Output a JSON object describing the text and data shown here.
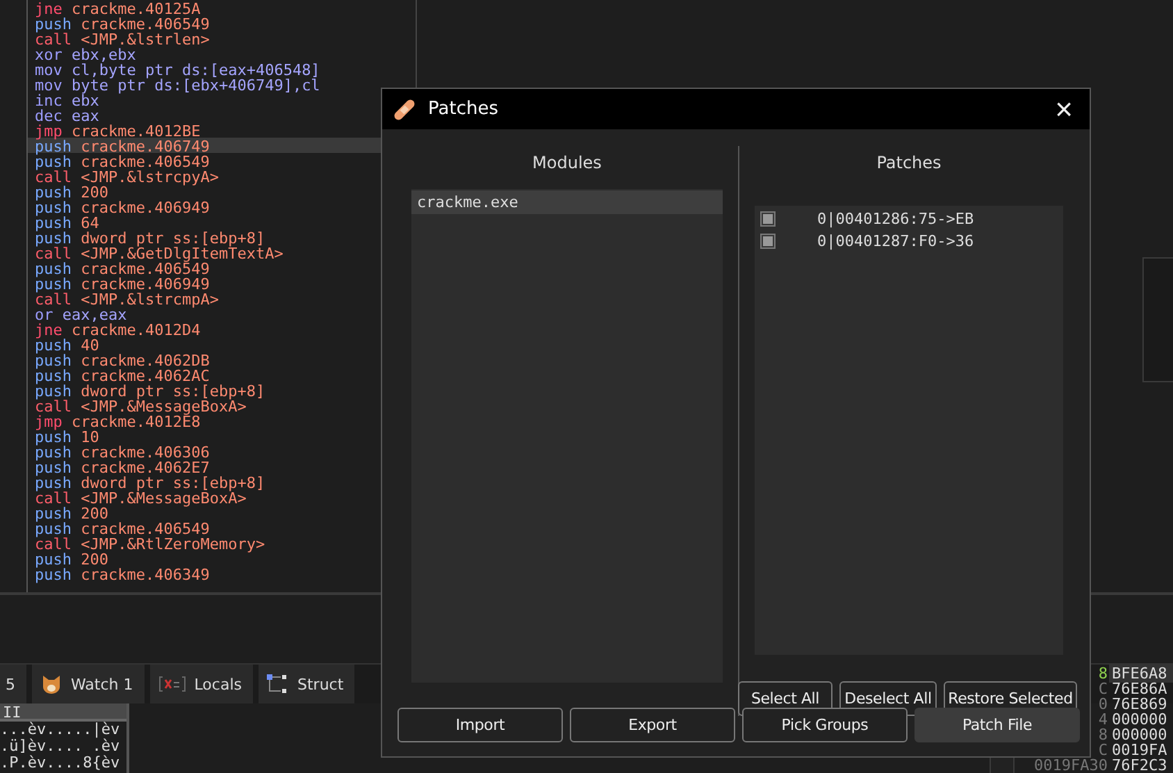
{
  "disassembly": [
    {
      "mnemonic": "jne",
      "operand": "crackme.40125A",
      "kind": "jump",
      "selected": false
    },
    {
      "mnemonic": "push",
      "operand": "crackme.406549",
      "kind": "stack",
      "selected": false
    },
    {
      "mnemonic": "call",
      "operand": "<JMP.&lstrlen>",
      "kind": "call",
      "selected": false
    },
    {
      "mnemonic": "xor",
      "operand": "ebx,ebx",
      "kind": "other",
      "selected": false
    },
    {
      "mnemonic": "mov",
      "operand": "cl,byte ptr ds:[eax+406548]",
      "kind": "other",
      "selected": false
    },
    {
      "mnemonic": "mov",
      "operand": "byte ptr ds:[ebx+406749],cl",
      "kind": "other",
      "selected": false
    },
    {
      "mnemonic": "inc",
      "operand": "ebx",
      "kind": "other",
      "selected": false
    },
    {
      "mnemonic": "dec",
      "operand": "eax",
      "kind": "other",
      "selected": false
    },
    {
      "mnemonic": "jmp",
      "operand": "crackme.4012BE",
      "kind": "jump",
      "selected": false
    },
    {
      "mnemonic": "push",
      "operand": "crackme.406749",
      "kind": "stack",
      "selected": true
    },
    {
      "mnemonic": "push",
      "operand": "crackme.406549",
      "kind": "stack",
      "selected": false
    },
    {
      "mnemonic": "call",
      "operand": "<JMP.&lstrcpyA>",
      "kind": "call",
      "selected": false
    },
    {
      "mnemonic": "push",
      "operand": "200",
      "kind": "stack",
      "selected": false
    },
    {
      "mnemonic": "push",
      "operand": "crackme.406949",
      "kind": "stack",
      "selected": false
    },
    {
      "mnemonic": "push",
      "operand": "64",
      "kind": "stack",
      "selected": false
    },
    {
      "mnemonic": "push",
      "operand": "dword ptr ss:[ebp+8]",
      "kind": "stack",
      "selected": false
    },
    {
      "mnemonic": "call",
      "operand": "<JMP.&GetDlgItemTextA>",
      "kind": "call",
      "selected": false
    },
    {
      "mnemonic": "push",
      "operand": "crackme.406549",
      "kind": "stack",
      "selected": false
    },
    {
      "mnemonic": "push",
      "operand": "crackme.406949",
      "kind": "stack",
      "selected": false
    },
    {
      "mnemonic": "call",
      "operand": "<JMP.&lstrcmpA>",
      "kind": "call",
      "selected": false
    },
    {
      "mnemonic": "or",
      "operand": "eax,eax",
      "kind": "other",
      "selected": false
    },
    {
      "mnemonic": "jne",
      "operand": "crackme.4012D4",
      "kind": "jump",
      "selected": false
    },
    {
      "mnemonic": "push",
      "operand": "40",
      "kind": "stack",
      "selected": false
    },
    {
      "mnemonic": "push",
      "operand": "crackme.4062DB",
      "kind": "stack",
      "selected": false
    },
    {
      "mnemonic": "push",
      "operand": "crackme.4062AC",
      "kind": "stack",
      "selected": false
    },
    {
      "mnemonic": "push",
      "operand": "dword ptr ss:[ebp+8]",
      "kind": "stack",
      "selected": false
    },
    {
      "mnemonic": "call",
      "operand": "<JMP.&MessageBoxA>",
      "kind": "call",
      "selected": false
    },
    {
      "mnemonic": "jmp",
      "operand": "crackme.4012E8",
      "kind": "jump",
      "selected": false
    },
    {
      "mnemonic": "push",
      "operand": "10",
      "kind": "stack",
      "selected": false
    },
    {
      "mnemonic": "push",
      "operand": "crackme.406306",
      "kind": "stack",
      "selected": false
    },
    {
      "mnemonic": "push",
      "operand": "crackme.4062E7",
      "kind": "stack",
      "selected": false
    },
    {
      "mnemonic": "push",
      "operand": "dword ptr ss:[ebp+8]",
      "kind": "stack",
      "selected": false
    },
    {
      "mnemonic": "call",
      "operand": "<JMP.&MessageBoxA>",
      "kind": "call",
      "selected": false
    },
    {
      "mnemonic": "push",
      "operand": "200",
      "kind": "stack",
      "selected": false
    },
    {
      "mnemonic": "push",
      "operand": "crackme.406549",
      "kind": "stack",
      "selected": false
    },
    {
      "mnemonic": "call",
      "operand": "<JMP.&RtlZeroMemory>",
      "kind": "call",
      "selected": false
    },
    {
      "mnemonic": "push",
      "operand": "200",
      "kind": "stack",
      "selected": false
    },
    {
      "mnemonic": "push",
      "operand": "crackme.406349",
      "kind": "stack",
      "selected": false
    }
  ],
  "tabs": [
    {
      "label": "5",
      "kind": "plain",
      "selected": false
    },
    {
      "label": "Watch 1",
      "kind": "watch",
      "selected": false
    },
    {
      "label": "Locals",
      "kind": "locals",
      "selected": false
    },
    {
      "label": "Struct",
      "kind": "struct",
      "selected": false
    }
  ],
  "dump": {
    "header": "II",
    "rows": [
      "...èv.....|èv",
      ".ü]èv.... .èv",
      ".P.èv....8{èv"
    ]
  },
  "stack": [
    {
      "address": "8",
      "value": "BFE6A8",
      "selected": true
    },
    {
      "address": "C",
      "value": "76E86A",
      "selected": false
    },
    {
      "address": "0",
      "value": "76E869",
      "selected": false
    },
    {
      "address": "4",
      "value": "000000",
      "selected": false
    },
    {
      "address": "8",
      "value": "000000",
      "selected": false
    },
    {
      "address": "C",
      "value": "0019FA",
      "selected": false
    },
    {
      "address": "0019FA30",
      "value": "76F2C3",
      "selected": false
    }
  ],
  "dialog": {
    "title": "Patches",
    "close": "×",
    "modules": {
      "heading": "Modules",
      "items": [
        {
          "label": "crackme.exe",
          "selected": true
        }
      ]
    },
    "patches": {
      "heading": "Patches",
      "items": [
        {
          "label": "0|00401286:75->EB",
          "checked": true
        },
        {
          "label": "0|00401287:F0->36",
          "checked": true
        }
      ]
    },
    "selection_buttons": [
      {
        "label": "Select All",
        "default": false
      },
      {
        "label": "Deselect All",
        "default": false
      },
      {
        "label": "Restore Selected",
        "default": false
      }
    ],
    "action_buttons": [
      {
        "label": "Import",
        "default": false
      },
      {
        "label": "Export",
        "default": false
      },
      {
        "label": "Pick Groups",
        "default": false
      },
      {
        "label": "Patch File",
        "default": true
      }
    ]
  }
}
